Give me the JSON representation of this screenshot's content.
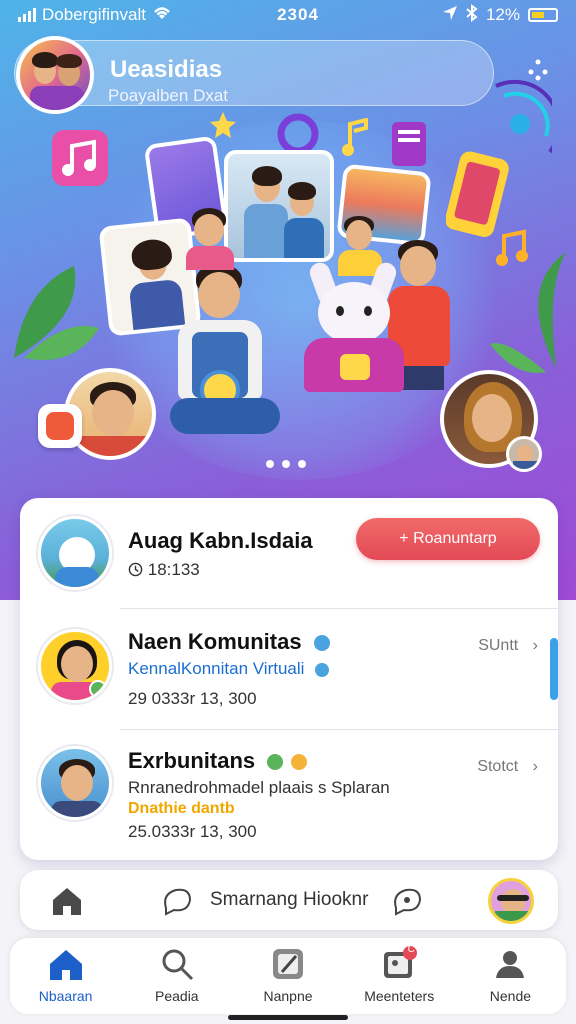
{
  "status_bar": {
    "carrier": "Dobergifinvalt",
    "time": "2304",
    "battery": "12%"
  },
  "profile": {
    "title": "Ueasidias",
    "subtitle": "Poayalben Dxat"
  },
  "feed": [
    {
      "title": "Auag Kabn.Isdaia",
      "time": "18:133",
      "action_label": "+ Roanuntarp"
    },
    {
      "title": "Naen Komunitas",
      "subtitle": "KennalKonnitan Virtuali",
      "meta": "29 0333r  13, 300",
      "right_label": "SUntt",
      "verified_color": "#4aa3df"
    },
    {
      "title": "Exrbunitans",
      "subtitle": "Rnranedrohmadel plaais s Splaran",
      "tag": "Dnathie dantb",
      "meta": "25.0333r  13, 300",
      "right_label": "Stotct"
    }
  ],
  "search": {
    "placeholder": "Smarnang Hiooknr"
  },
  "tabs": [
    {
      "label": "Nbaaran",
      "icon": "home-icon",
      "active": true
    },
    {
      "label": "Peadia",
      "icon": "search-icon"
    },
    {
      "label": "Nanpne",
      "icon": "note-icon"
    },
    {
      "label": "Meenteters",
      "icon": "gallery-icon",
      "badge": "C"
    },
    {
      "label": "Nende",
      "icon": "person-icon"
    }
  ],
  "colors": {
    "accent": "#e24a55",
    "link": "#1b6fd1",
    "tab_active": "#1d5fc8",
    "hero_start": "#4fb4e8",
    "hero_end": "#a04ad6"
  }
}
